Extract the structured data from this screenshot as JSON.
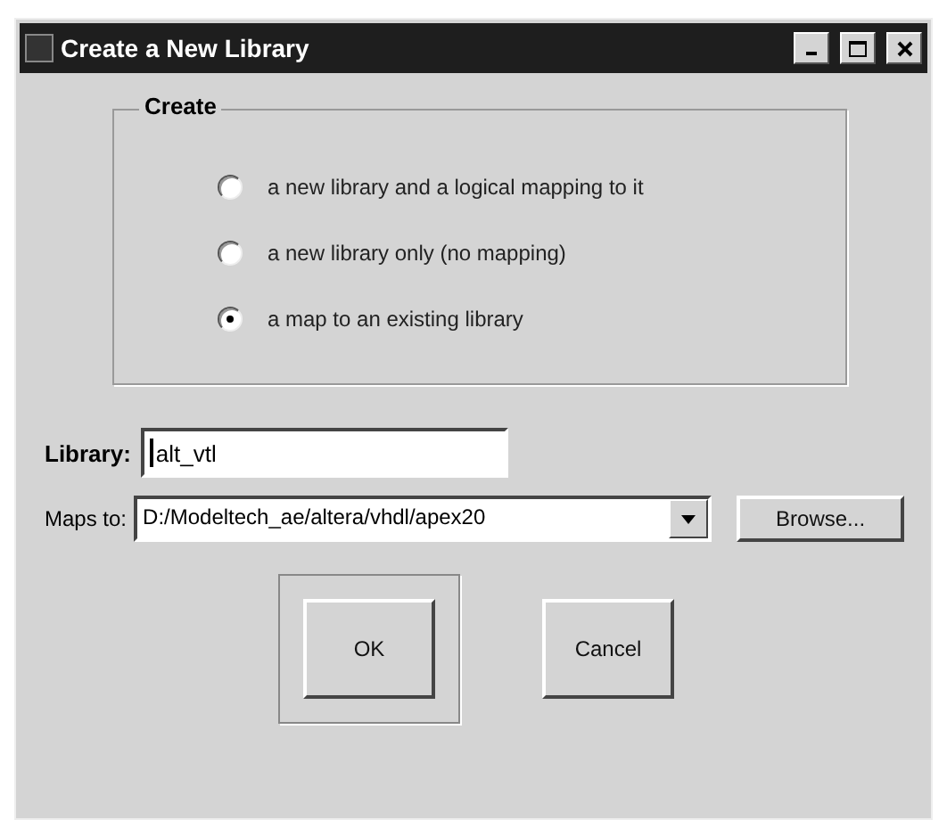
{
  "window": {
    "title": "Create a New Library"
  },
  "create_group": {
    "title": "Create",
    "options": [
      {
        "label": "a new library and a logical mapping to it",
        "selected": false
      },
      {
        "label": "a new library only (no mapping)",
        "selected": false
      },
      {
        "label": "a map to an existing library",
        "selected": true
      }
    ]
  },
  "library": {
    "label": "Library:",
    "value": "alt_vtl"
  },
  "maps_to": {
    "label": "Maps to:",
    "value": "D:/Modeltech_ae/altera/vhdl/apex20",
    "browse": "Browse..."
  },
  "buttons": [
    {
      "label": "OK",
      "default": true
    },
    {
      "label": "Cancel",
      "default": false
    }
  ]
}
